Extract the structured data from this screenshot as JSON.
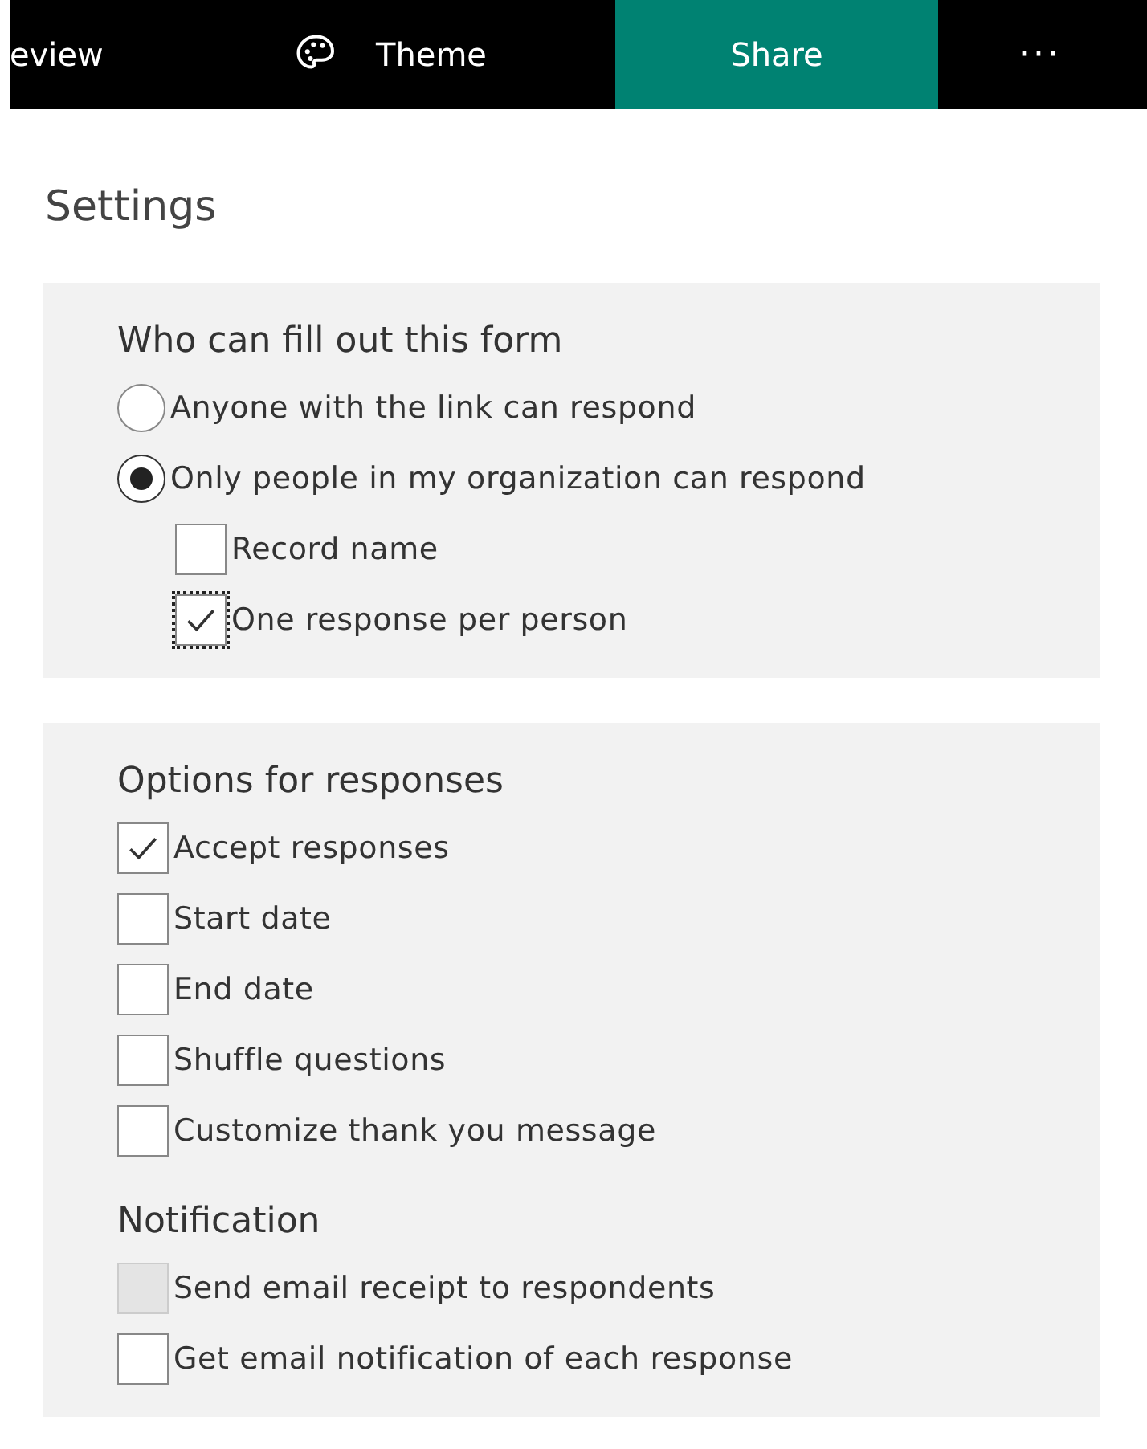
{
  "toolbar": [
    {
      "kind": "text",
      "label": "eview"
    },
    {
      "kind": "theme",
      "label": "Theme"
    },
    {
      "kind": "primary",
      "label": "Share"
    },
    {
      "kind": "more",
      "label": "···"
    }
  ],
  "title": "Settings",
  "panels": [
    {
      "groups": [
        {
          "title": "Who can fill out this form",
          "items": [
            {
              "kind": "radio",
              "label": "Anyone with the link can respond",
              "selected": false
            },
            {
              "kind": "radio",
              "label": "Only people in my organization can respond",
              "selected": true,
              "children": [
                {
                  "kind": "checkbox",
                  "label": "Record name",
                  "checked": false,
                  "focused": false,
                  "disabled": false
                },
                {
                  "kind": "checkbox",
                  "label": "One response per person",
                  "checked": true,
                  "focused": true,
                  "disabled": false
                }
              ]
            }
          ]
        }
      ]
    },
    {
      "groups": [
        {
          "title": "Options for responses",
          "items": [
            {
              "kind": "checkbox",
              "label": "Accept responses",
              "checked": true,
              "focused": false,
              "disabled": false
            },
            {
              "kind": "checkbox",
              "label": "Start date",
              "checked": false,
              "focused": false,
              "disabled": false
            },
            {
              "kind": "checkbox",
              "label": "End date",
              "checked": false,
              "focused": false,
              "disabled": false
            },
            {
              "kind": "checkbox",
              "label": "Shuffle questions",
              "checked": false,
              "focused": false,
              "disabled": false
            },
            {
              "kind": "checkbox",
              "label": "Customize thank you message",
              "checked": false,
              "focused": false,
              "disabled": false
            }
          ]
        },
        {
          "title": "Notification",
          "items": [
            {
              "kind": "checkbox",
              "label": "Send email receipt to respondents",
              "checked": false,
              "focused": false,
              "disabled": true
            },
            {
              "kind": "checkbox",
              "label": "Get email notification of each response",
              "checked": false,
              "focused": false,
              "disabled": false
            }
          ]
        }
      ]
    }
  ]
}
